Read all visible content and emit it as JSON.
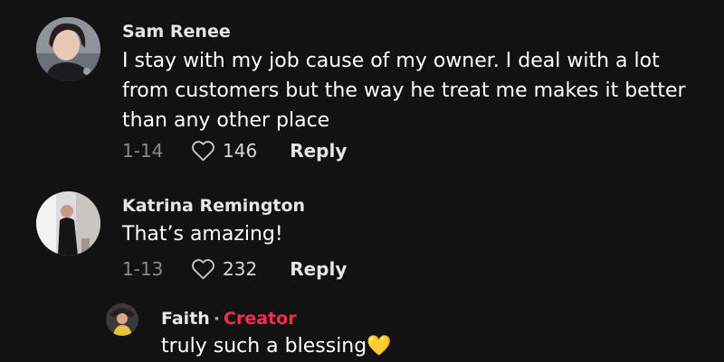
{
  "comments": [
    {
      "username": "Sam  Renee",
      "text": "I stay with my job cause of my owner. I deal with a lot from customers but the way he treat me makes it better than any other place",
      "date": "1-14",
      "likes": "146",
      "reply_label": "Reply"
    },
    {
      "username": "Katrina Remington",
      "text": "That’s amazing!",
      "date": "1-13",
      "likes": "232",
      "reply_label": "Reply"
    }
  ],
  "reply": {
    "username": "Faith",
    "separator": "·",
    "badge": "Creator",
    "text": "truly such a blessing💛"
  },
  "colors": {
    "background": "#121212",
    "creator_badge": "#fe2c55",
    "muted": "#8a8a8a"
  },
  "icons": {
    "like": "heart-outline-icon"
  }
}
